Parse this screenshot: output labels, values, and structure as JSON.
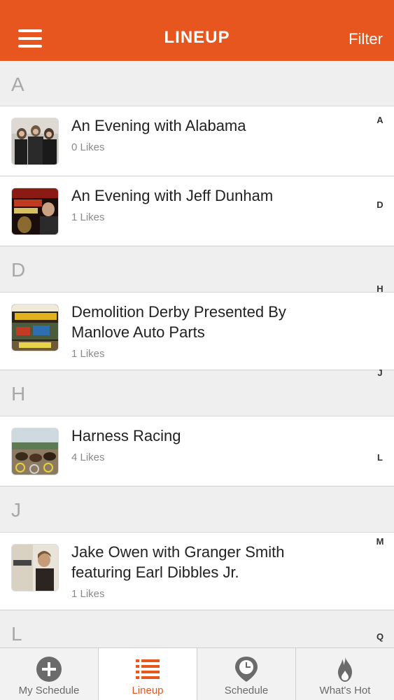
{
  "header": {
    "title": "LINEUP",
    "filter_label": "Filter"
  },
  "sections": [
    {
      "letter": "A"
    },
    {
      "letter": "D"
    },
    {
      "letter": "H"
    },
    {
      "letter": "J"
    },
    {
      "letter": "L"
    }
  ],
  "items": [
    {
      "title_lines": [
        "An Evening with Alabama"
      ],
      "likes": "0 Likes"
    },
    {
      "title_lines": [
        "An Evening with Jeff Dunham"
      ],
      "likes": "1 Likes"
    },
    {
      "title_lines": [
        "Demolition Derby Presented By",
        "Manlove Auto Parts"
      ],
      "likes": "1 Likes"
    },
    {
      "title_lines": [
        "Harness Racing"
      ],
      "likes": "4 Likes"
    },
    {
      "title_lines": [
        "Jake Owen with Granger Smith",
        "featuring Earl Dibbles Jr."
      ],
      "likes": "1 Likes"
    }
  ],
  "index": [
    "A",
    "D",
    "H",
    "J",
    "L",
    "M",
    "Q"
  ],
  "tabs": [
    {
      "label": "My Schedule",
      "icon": "plus-circle-icon",
      "active": false
    },
    {
      "label": "Lineup",
      "icon": "list-icon",
      "active": true
    },
    {
      "label": "Schedule",
      "icon": "clock-pin-icon",
      "active": false
    },
    {
      "label": "What's Hot",
      "icon": "flame-icon",
      "active": false
    }
  ],
  "colors": {
    "accent": "#e8561f",
    "section_bg": "#efefef",
    "tab_bg": "#f2f2f2"
  }
}
